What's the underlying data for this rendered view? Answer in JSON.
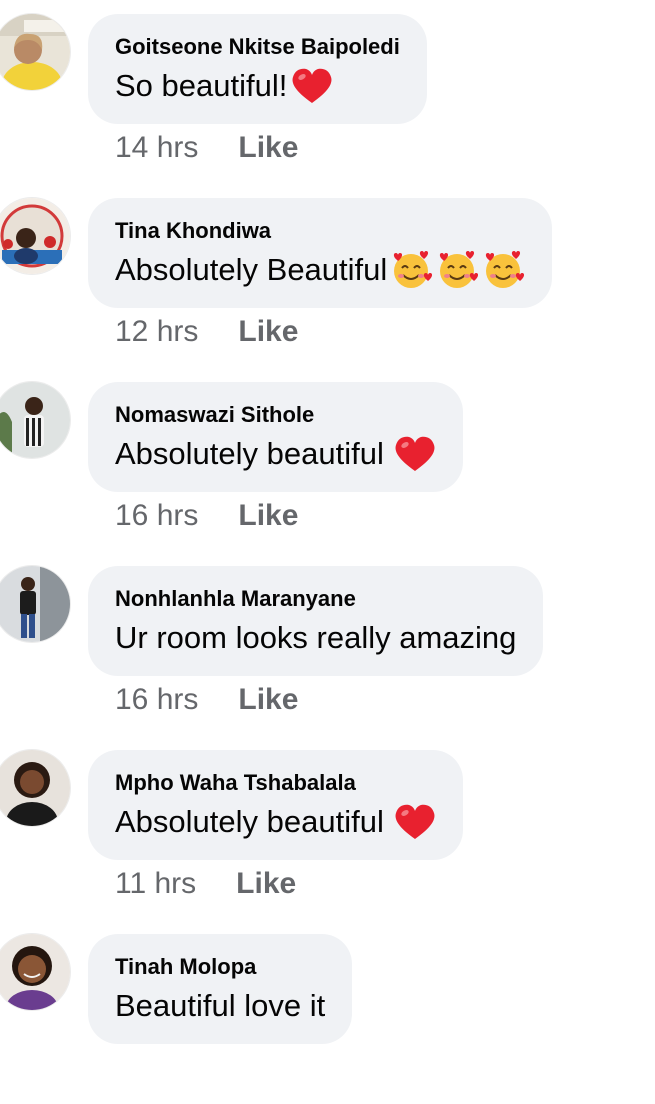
{
  "comments": [
    {
      "author": "Goitseone Nkitse Baipoledi",
      "text": "So beautiful!",
      "emoji": "heart-emoji",
      "time": "14 hrs",
      "like": "Like"
    },
    {
      "author": "Tina Khondiwa",
      "text": "Absolutely Beautiful",
      "emoji": "smiling-face-with-hearts-emoji",
      "time": "12 hrs",
      "like": "Like"
    },
    {
      "author": "Nomaswazi Sithole",
      "text": "Absolutely beautiful",
      "emoji": "heart-emoji",
      "time": "16 hrs",
      "like": "Like"
    },
    {
      "author": "Nonhlanhla Maranyane",
      "text": "Ur room looks really amazing",
      "time": "16 hrs",
      "like": "Like"
    },
    {
      "author": "Mpho Waha Tshabalala",
      "text": "Absolutely beautiful",
      "emoji": "heart-emoji",
      "time": "11 hrs",
      "like": "Like"
    },
    {
      "author": "Tinah Molopa",
      "text": "Beautiful love it"
    }
  ],
  "colors": {
    "bubble": "#f0f2f5",
    "text": "#050505",
    "meta": "#65676b",
    "heart": "#e8212f"
  }
}
